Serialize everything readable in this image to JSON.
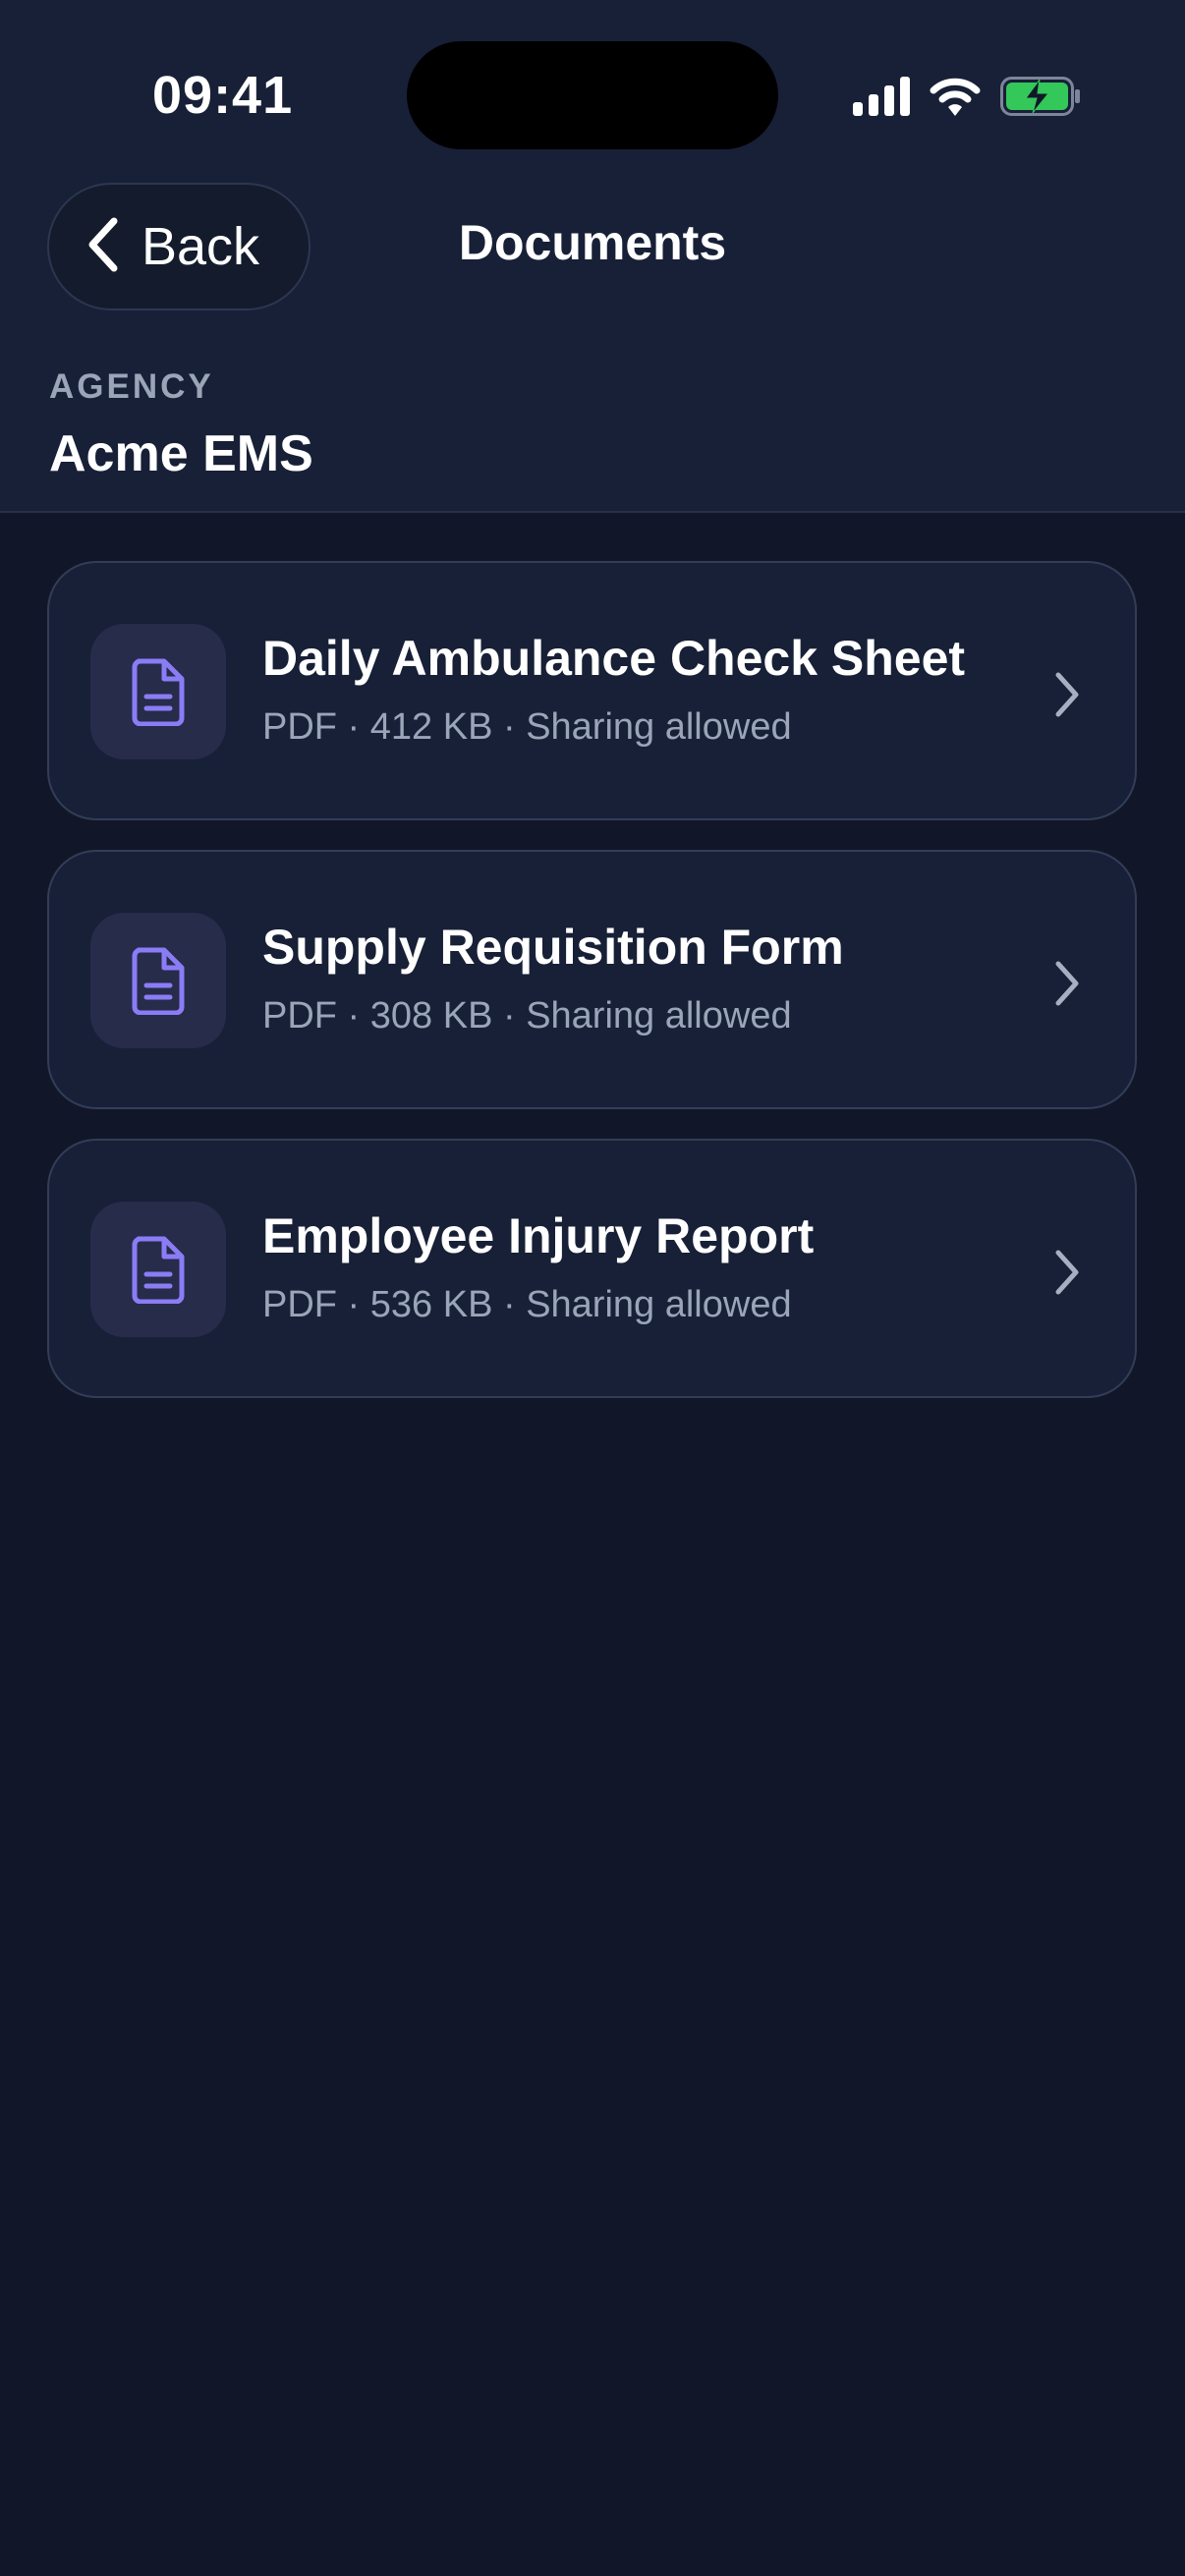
{
  "status_bar": {
    "time": "09:41"
  },
  "nav": {
    "back_label": "Back",
    "title": "Documents"
  },
  "agency": {
    "caption": "AGENCY",
    "name": "Acme EMS"
  },
  "documents": [
    {
      "title": "Daily Ambulance Check Sheet",
      "meta": "PDF · 412 KB · Sharing allowed",
      "icon": "document-icon"
    },
    {
      "title": "Supply Requisition Form",
      "meta": "PDF · 308 KB · Sharing allowed",
      "icon": "document-icon"
    },
    {
      "title": "Employee Injury Report",
      "meta": "PDF · 536 KB · Sharing allowed",
      "icon": "document-icon"
    }
  ],
  "colors": {
    "background": "#111729",
    "header_background": "#172036",
    "card_background": "#172036",
    "icon_tile": "#262c4a",
    "icon_accent": "#8b7cf6",
    "secondary_text": "#9aa5b8",
    "battery_green": "#34c759"
  }
}
